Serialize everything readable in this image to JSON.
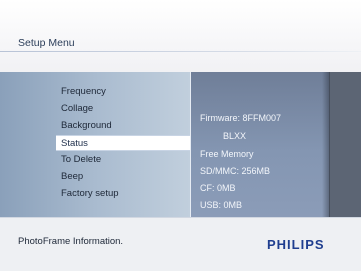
{
  "header": {
    "title": "Setup Menu"
  },
  "menu": {
    "items": [
      "Frequency",
      "Collage",
      "Background",
      "Status",
      "To Delete",
      "Beep",
      "Factory setup"
    ],
    "selected": "Status"
  },
  "info": {
    "lines": [
      "Firmware: 8FFM007",
      "BLXX",
      "Free Memory",
      "SD/MMC: 256MB",
      "CF: 0MB",
      "USB: 0MB"
    ]
  },
  "footer": {
    "status": "PhotoFrame Information.",
    "logo": "PHILIPS"
  },
  "colors": {
    "brand": "#1f3e8f",
    "menu_panel": "#a9bbcf",
    "info_panel": "#8496b2",
    "dark_band": "#5f6878"
  }
}
